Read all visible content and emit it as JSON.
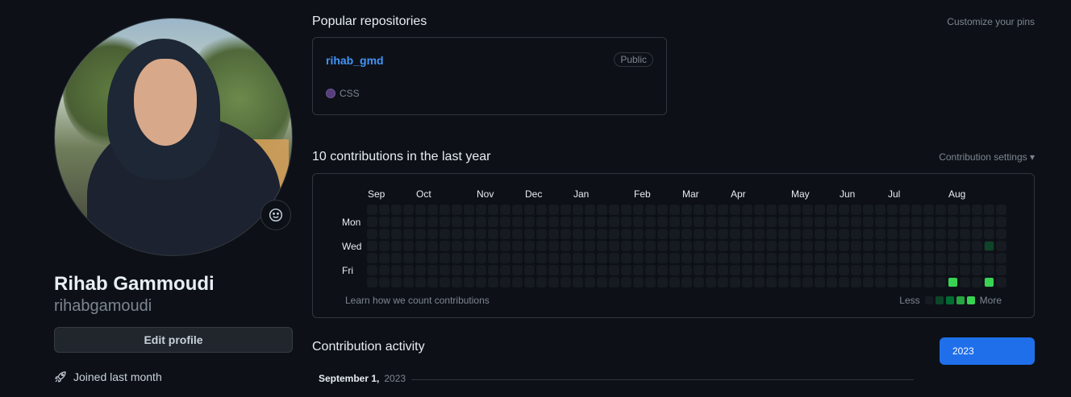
{
  "profile": {
    "name": "Rihab Gammoudi",
    "login": "rihabgamoudi",
    "edit_label": "Edit profile",
    "joined": "Joined last month",
    "status_icon": "smiley-icon",
    "joined_icon": "rocket-icon"
  },
  "popular": {
    "title": "Popular repositories",
    "customize": "Customize your pins",
    "repos": [
      {
        "name": "rihab_gmd",
        "visibility": "Public",
        "language": "CSS",
        "language_color": "#563d7c"
      }
    ]
  },
  "contributions": {
    "title": "10 contributions in the last year",
    "settings": "Contribution settings",
    "months": [
      "Sep",
      "Oct",
      "Nov",
      "Dec",
      "Jan",
      "Feb",
      "Mar",
      "Apr",
      "May",
      "Jun",
      "Jul",
      "Aug"
    ],
    "days": [
      "Mon",
      "Wed",
      "Fri"
    ],
    "learn": "Learn how we count contributions",
    "legend_less": "Less",
    "legend_more": "More",
    "levels": [
      "#161b22",
      "#0e4429",
      "#006d32",
      "#26a641",
      "#39d353"
    ],
    "weeks": 53,
    "active_cells": [
      {
        "week": 51,
        "day": 3,
        "level": 1
      },
      {
        "week": 48,
        "day": 6,
        "level": 4
      },
      {
        "week": 51,
        "day": 6,
        "level": 4
      }
    ]
  },
  "activity": {
    "title": "Contribution activity",
    "year": "2023",
    "month_label": "September 1,",
    "month_year": "2023"
  },
  "colors": {
    "background": "#0d1117",
    "accent": "#1f6feb",
    "link": "#4493f8"
  }
}
